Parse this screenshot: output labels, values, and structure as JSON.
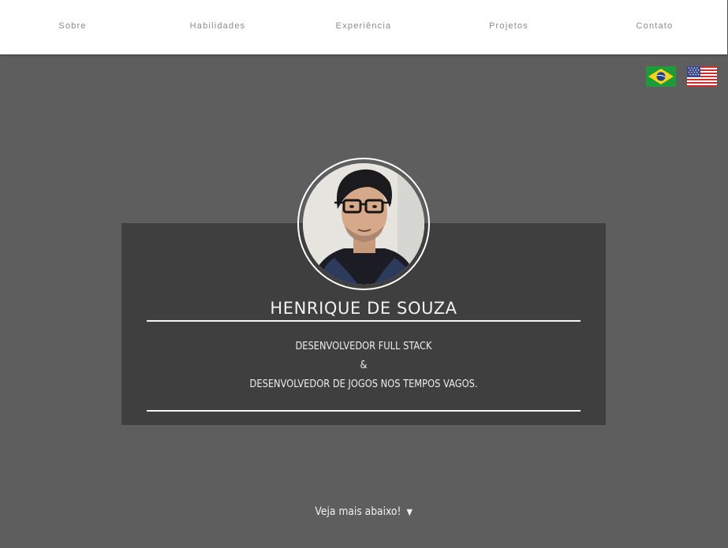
{
  "nav": {
    "items": [
      {
        "label": "Sobre"
      },
      {
        "label": "Habilidades"
      },
      {
        "label": "Experiência"
      },
      {
        "label": "Projetos"
      },
      {
        "label": "Contato"
      }
    ]
  },
  "language_flags": [
    {
      "icon": "brazil-flag-icon"
    },
    {
      "icon": "usa-flag-icon"
    }
  ],
  "profile": {
    "name": "HENRIQUE DE SOUZA",
    "line1": "DESENVOLVEDOR FULL STACK",
    "line2": "&",
    "line3": "DESENVOLVEDOR DE JOGOS NOS TEMPOS VAGOS."
  },
  "scroll_hint": {
    "label": "Veja mais abaixo!",
    "icon": "triangle-down-icon"
  },
  "colors": {
    "background": "#5e5e5e",
    "card": "#3f3f3f",
    "navbar": "#ffffff",
    "nav_text": "#8a8a8a",
    "text": "#f2f2f2"
  }
}
